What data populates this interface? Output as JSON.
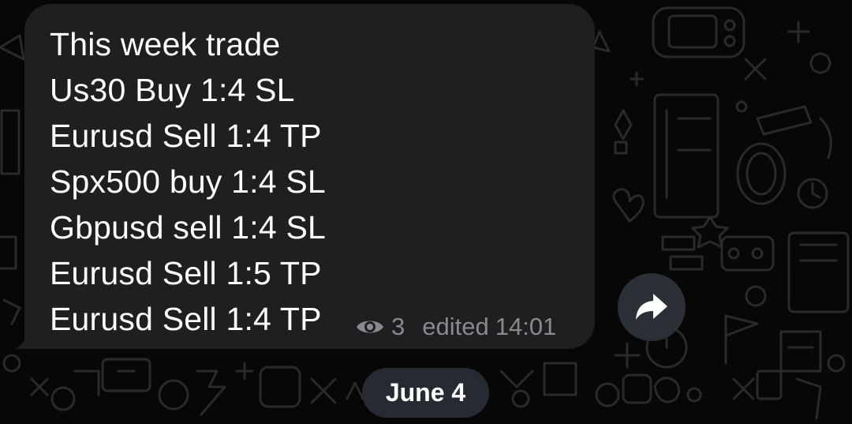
{
  "message": {
    "lines": [
      "This week trade",
      "Us30 Buy 1:4 SL",
      "Eurusd Sell 1:4 TP",
      "Spx500 buy 1:4 SL",
      "Gbpusd sell 1:4 SL",
      "Eurusd Sell 1:5 TP",
      "Eurusd Sell 1:4 TP"
    ],
    "views": "3",
    "edited_label": "edited",
    "time": "14:01"
  },
  "date_separator": "June 4",
  "icons": {
    "views": "eye-icon",
    "forward": "forward-arrow-icon"
  },
  "colors": {
    "background": "#070707",
    "bubble": "#1f1f21",
    "text": "#ffffff",
    "meta_text": "#8a8a8e",
    "forward_button": "#2b3036",
    "date_pill": "#262b33"
  }
}
